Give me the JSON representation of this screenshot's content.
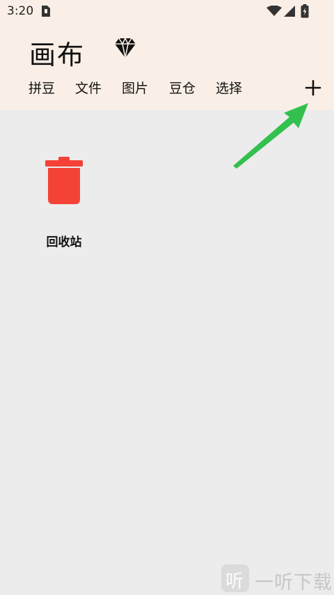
{
  "status_bar": {
    "time": "3:20",
    "icons": [
      "sim-card-icon",
      "wifi-icon",
      "cell-signal-icon",
      "battery-charging-icon"
    ]
  },
  "header": {
    "title": "画布",
    "premium_icon": "diamond-icon",
    "background": "#faefe6"
  },
  "tabs": [
    {
      "label": "拼豆"
    },
    {
      "label": "文件"
    },
    {
      "label": "图片"
    },
    {
      "label": "豆仓"
    },
    {
      "label": "选择"
    }
  ],
  "add_button": {
    "icon": "plus-icon"
  },
  "annotation": {
    "icon": "arrow-icon",
    "color": "#33c04e"
  },
  "items": [
    {
      "label": "回收站",
      "icon": "trash-icon",
      "color": "#f44336"
    }
  ],
  "watermark": {
    "logo_glyph": "听",
    "text": "一听下载"
  }
}
